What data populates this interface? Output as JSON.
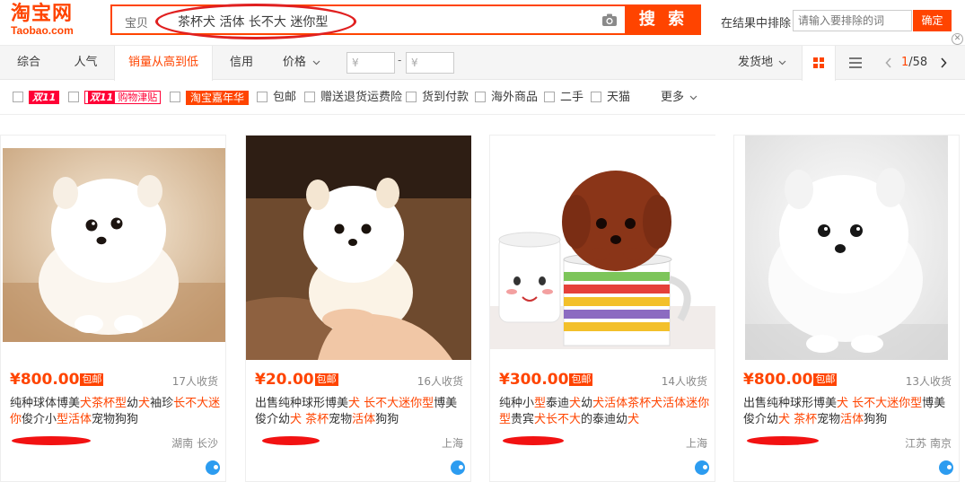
{
  "header": {
    "logo_cn": "淘宝网",
    "logo_en": "Taobao.com",
    "search_scope": "宝贝",
    "search_query": "茶杯犬 活体 长不大 迷你型",
    "search_button": "搜 索",
    "exclude_label": "在结果中排除",
    "exclude_placeholder": "请输入要排除的词",
    "confirm_button": "确定"
  },
  "sortbar": {
    "tabs": [
      "综合",
      "人气",
      "销量从高到低",
      "信用",
      "价格"
    ],
    "price_min_placeholder": "¥",
    "price_max_placeholder": "¥",
    "price_dash": "-",
    "ship_from": "发货地",
    "page_current": "1",
    "page_total": "/58"
  },
  "filters": {
    "double11": "双11",
    "double11_subsidy_badge": "双11",
    "double11_subsidy": "购物津贴",
    "carnival": "淘宝嘉年华",
    "free_shipping": "包邮",
    "return_insurance": "赠送退货运费险",
    "cod": "货到付款",
    "overseas": "海外商品",
    "secondhand": "二手",
    "tmall": "天猫",
    "more": "更多"
  },
  "products": [
    {
      "price": "¥800.00",
      "badge": "包邮",
      "sold": "17人收货",
      "title_parts": [
        {
          "t": "纯种球体博美",
          "hl": false
        },
        {
          "t": "犬茶杯型",
          "hl": true
        },
        {
          "t": "幼",
          "hl": false
        },
        {
          "t": "犬",
          "hl": true
        },
        {
          "t": "袖珍",
          "hl": false
        },
        {
          "t": "长不大迷你",
          "hl": true
        },
        {
          "t": "俊介小",
          "hl": false
        },
        {
          "t": "型活体",
          "hl": true
        },
        {
          "t": "宠物狗狗",
          "hl": false
        }
      ],
      "location": "湖南 长沙"
    },
    {
      "price": "¥20.00",
      "badge": "包邮",
      "sold": "16人收货",
      "title_parts": [
        {
          "t": "出售纯种球形博美",
          "hl": false
        },
        {
          "t": "犬 长不大迷你型",
          "hl": true
        },
        {
          "t": "博美俊介幼",
          "hl": false
        },
        {
          "t": "犬 茶杯",
          "hl": true
        },
        {
          "t": "宠物",
          "hl": false
        },
        {
          "t": "活体",
          "hl": true
        },
        {
          "t": "狗狗",
          "hl": false
        }
      ],
      "location": "上海"
    },
    {
      "price": "¥300.00",
      "badge": "包邮",
      "sold": "14人收货",
      "title_parts": [
        {
          "t": "纯种小",
          "hl": false
        },
        {
          "t": "型",
          "hl": true
        },
        {
          "t": "泰迪",
          "hl": false
        },
        {
          "t": "犬",
          "hl": true
        },
        {
          "t": "幼",
          "hl": false
        },
        {
          "t": "犬活体茶杯犬活体迷你型",
          "hl": true
        },
        {
          "t": "贵宾",
          "hl": false
        },
        {
          "t": "犬长不大",
          "hl": true
        },
        {
          "t": "的泰迪幼",
          "hl": false
        },
        {
          "t": "犬",
          "hl": true
        }
      ],
      "location": "上海"
    },
    {
      "price": "¥800.00",
      "badge": "包邮",
      "sold": "13人收货",
      "title_parts": [
        {
          "t": "出售纯种球形博美",
          "hl": false
        },
        {
          "t": "犬 长不大迷你型",
          "hl": true
        },
        {
          "t": "博美俊介幼",
          "hl": false
        },
        {
          "t": "犬 茶杯",
          "hl": true
        },
        {
          "t": "宠物",
          "hl": false
        },
        {
          "t": "活体",
          "hl": true
        },
        {
          "t": "狗狗",
          "hl": false
        }
      ],
      "location": "江苏 南京"
    }
  ],
  "colors": {
    "accent": "#ff4400",
    "double11": "#ff0036",
    "annotation_red": "#e02020",
    "wangwang_blue": "#2c9cf0"
  }
}
